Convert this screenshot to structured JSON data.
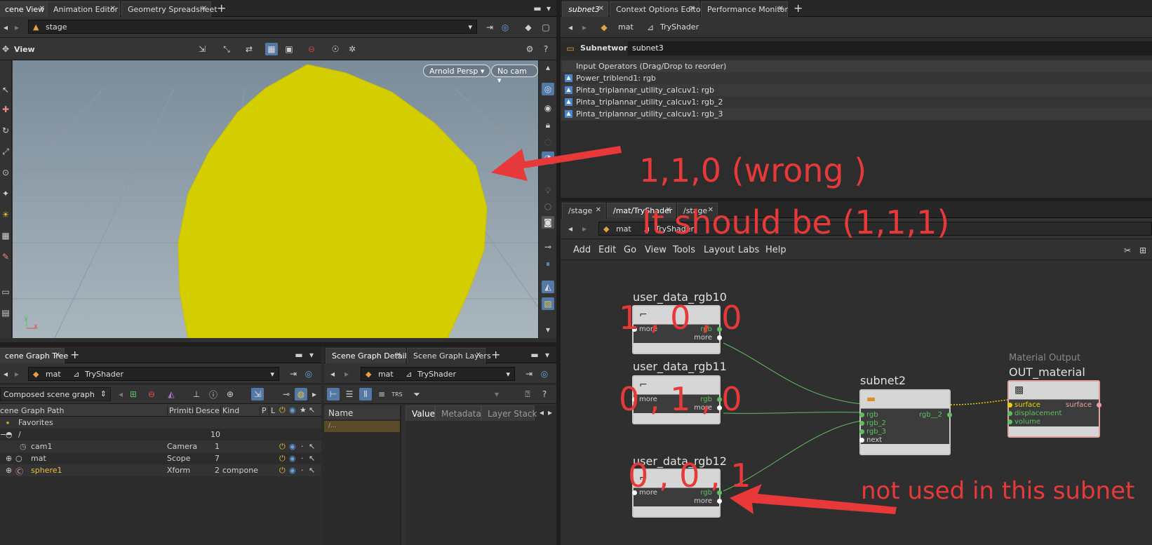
{
  "scene_view": {
    "tabs": [
      "cene View",
      "Animation Editor",
      "Geometry Spreadsheet"
    ],
    "path": "stage",
    "view_label": "View",
    "renderer_btn": "Arnold Persp",
    "camera_btn": "No cam",
    "axis_y": "y",
    "axis_x": "x"
  },
  "right_top": {
    "tabs": [
      "subnet3",
      "Context Options Editor",
      "Performance Monitor"
    ],
    "path_mat": "mat",
    "path_shader": "TryShader",
    "subnetwork_label": "Subnetwork",
    "subnetwork_name": "subnet3",
    "input_ops_header": "Input Operators (Drag/Drop to reorder)",
    "inputs": [
      "Power_triblend1: rgb",
      "Pinta_triplannar_utility_calcuv1: rgb",
      "Pinta_triplannar_utility_calcuv1: rgb_2",
      "Pinta_triplannar_utility_calcuv1: rgb_3"
    ]
  },
  "network": {
    "tabs": [
      "/stage",
      "/mat/TryShader",
      "/stage"
    ],
    "path_mat": "mat",
    "path_shader": "TryShader",
    "menu": [
      "Add",
      "Edit",
      "Go",
      "View",
      "Tools",
      "Layout",
      "Labs",
      "Help"
    ],
    "nodes": {
      "n10": {
        "title": "user_data_rgb10",
        "in": "more",
        "out": "rgb",
        "out2": "more"
      },
      "n11": {
        "title": "user_data_rgb11",
        "in": "more",
        "out": "rgb",
        "out2": "more"
      },
      "n12": {
        "title": "user_data_rgb12",
        "in": "more",
        "out": "rgb",
        "out2": "more"
      },
      "subnet": {
        "title": "subnet2",
        "in1": "rgb",
        "in2": "rgb_2",
        "in3": "rgb_3",
        "in4": "next",
        "out": "rgb__2"
      },
      "out": {
        "subtitle": "Material Output",
        "title": "OUT_material",
        "in1": "surface",
        "in2": "displacement",
        "in3": "volume",
        "out": "surface"
      }
    }
  },
  "scene_graph_tree": {
    "tab": "cene Graph Tree",
    "path_mat": "mat",
    "path_shader": "TryShader",
    "mode": "Composed scene graph",
    "columns": [
      "cene Graph Path",
      "Primiti",
      "Desce",
      "Kind",
      "P",
      "L"
    ],
    "favorites": "Favorites",
    "root": {
      "name": "/",
      "desc": "10"
    },
    "rows": [
      {
        "name": "cam1",
        "prim": "Camera",
        "desc": "1",
        "kind": ""
      },
      {
        "name": "mat",
        "prim": "Scope",
        "desc": "7",
        "kind": ""
      },
      {
        "name": "sphere1",
        "prim": "Xform",
        "desc": "2",
        "kind": "compone"
      }
    ]
  },
  "scene_graph_details": {
    "tabs": [
      "Scene Graph Details",
      "Scene Graph Layers"
    ],
    "path_mat": "mat",
    "path_shader": "TryShader",
    "name_col": "Name",
    "name_row": "/...",
    "value_tabs": [
      "Value",
      "Metadata",
      "Layer Stack"
    ]
  },
  "annotations": {
    "wrong": "1,1,0 (wrong )",
    "should": "It should be (1,1,1)",
    "v10": "1 ,  0 ,  0",
    "v11": "0 ,  1 ,  0",
    "v12": "0 ,  0 ,  1",
    "unused": "not used in this subnet"
  },
  "colors": {
    "sphere": "#d4cd00",
    "annotation": "#e8393a",
    "wire_green": "#5fbf5f",
    "wire_yellow": "#e8d400"
  }
}
